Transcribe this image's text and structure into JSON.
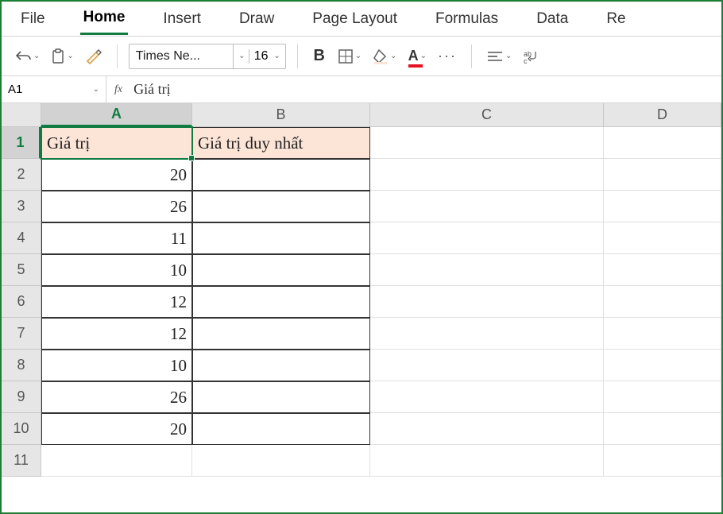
{
  "ribbon": {
    "tabs": [
      "File",
      "Home",
      "Insert",
      "Draw",
      "Page Layout",
      "Formulas",
      "Data",
      "Re"
    ],
    "active_index": 1
  },
  "toolbar": {
    "font_name": "Times Ne...",
    "font_size": "16"
  },
  "namebox": "A1",
  "fx_label": "fx",
  "formula_value": "Giá trị",
  "columns": [
    "A",
    "B",
    "C",
    "D"
  ],
  "rows": [
    "1",
    "2",
    "3",
    "4",
    "5",
    "6",
    "7",
    "8",
    "9",
    "10",
    "11"
  ],
  "selected_cell": {
    "row": 0,
    "col": 0
  },
  "cells": {
    "A1": "Giá trị",
    "B1": "Giá trị duy nhất",
    "A2": "20",
    "A3": "26",
    "A4": "11",
    "A5": "10",
    "A6": "12",
    "A7": "12",
    "A8": "10",
    "A9": "26",
    "A10": "20"
  }
}
